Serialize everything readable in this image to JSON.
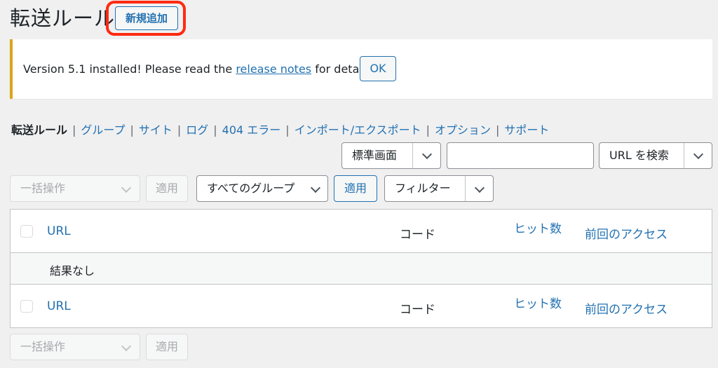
{
  "page": {
    "title": "転送ルール",
    "add_new_label": "新規追加"
  },
  "notice": {
    "text_before": "Version 5.1 installed! Please read the ",
    "link_text": "release notes",
    "text_after": " for details.",
    "ok_label": "OK",
    "border_color": "#dba617"
  },
  "subnav": {
    "items": [
      "転送ルール",
      "グループ",
      "サイト",
      "ログ",
      "404 エラー",
      "インポート/エクスポート",
      "オプション",
      "サポート"
    ],
    "separator": "|"
  },
  "search_bar": {
    "display_select": "標準画面",
    "search_input": "",
    "search_select": "URL を検索"
  },
  "filters_top": {
    "bulk_action": "一括操作",
    "bulk_apply": "適用",
    "group_select": "すべてのグループ",
    "group_apply": "適用",
    "filter_select": "フィルター"
  },
  "table": {
    "columns": {
      "url": "URL",
      "code": "コード",
      "hits": "ヒット数",
      "last_access": "前回のアクセス"
    },
    "empty_message": "結果なし"
  },
  "filters_bottom": {
    "bulk_action": "一括操作",
    "bulk_apply": "適用"
  },
  "colors": {
    "accent": "#2271b1",
    "highlight_ring": "#ff2a12"
  }
}
